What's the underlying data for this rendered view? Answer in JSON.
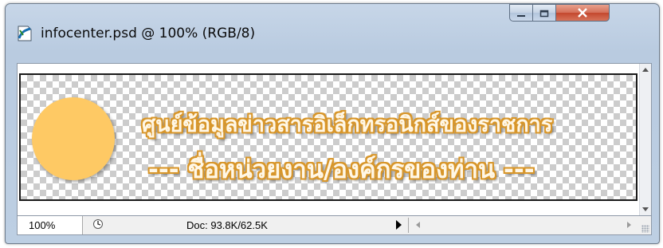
{
  "window": {
    "title": "infocenter.psd @ 100% (RGB/8)",
    "icon": "photoshop-document-icon"
  },
  "controls": {
    "minimize_icon": "minimize-icon",
    "maximize_icon": "maximize-icon",
    "close_icon": "close-icon",
    "close_color": "#c4482e"
  },
  "canvas": {
    "line1": "ศูนย์ข้อมูลข่าวสารอิเล็กทรอนิกส์ของราชการ",
    "line2": "--- ชื่อหน่วยงาน/องค์กรของท่าน ---",
    "circle_color": "#fec964",
    "text_outline_color": "#d8962a"
  },
  "status": {
    "zoom": "100%",
    "doc_info": "Doc: 93.8K/62.5K"
  }
}
